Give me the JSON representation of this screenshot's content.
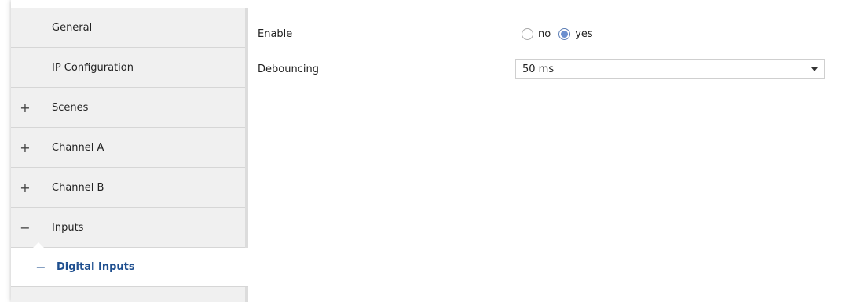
{
  "sidebar": {
    "items": [
      {
        "label": "General",
        "toggle": ""
      },
      {
        "label": "IP Configuration",
        "toggle": ""
      },
      {
        "label": "Scenes",
        "toggle": "+"
      },
      {
        "label": "Channel A",
        "toggle": "+"
      },
      {
        "label": "Channel B",
        "toggle": "+"
      },
      {
        "label": "Inputs",
        "toggle": "−"
      },
      {
        "label": "Digital Inputs",
        "toggle": "−"
      }
    ]
  },
  "params": {
    "enable": {
      "label": "Enable",
      "options": [
        "no",
        "yes"
      ],
      "selected": "yes"
    },
    "debouncing": {
      "label": "Debouncing",
      "value": "50 ms"
    }
  },
  "colors": {
    "active_text": "#1f4f8f",
    "sidebar_bg": "#f0f0f0"
  }
}
